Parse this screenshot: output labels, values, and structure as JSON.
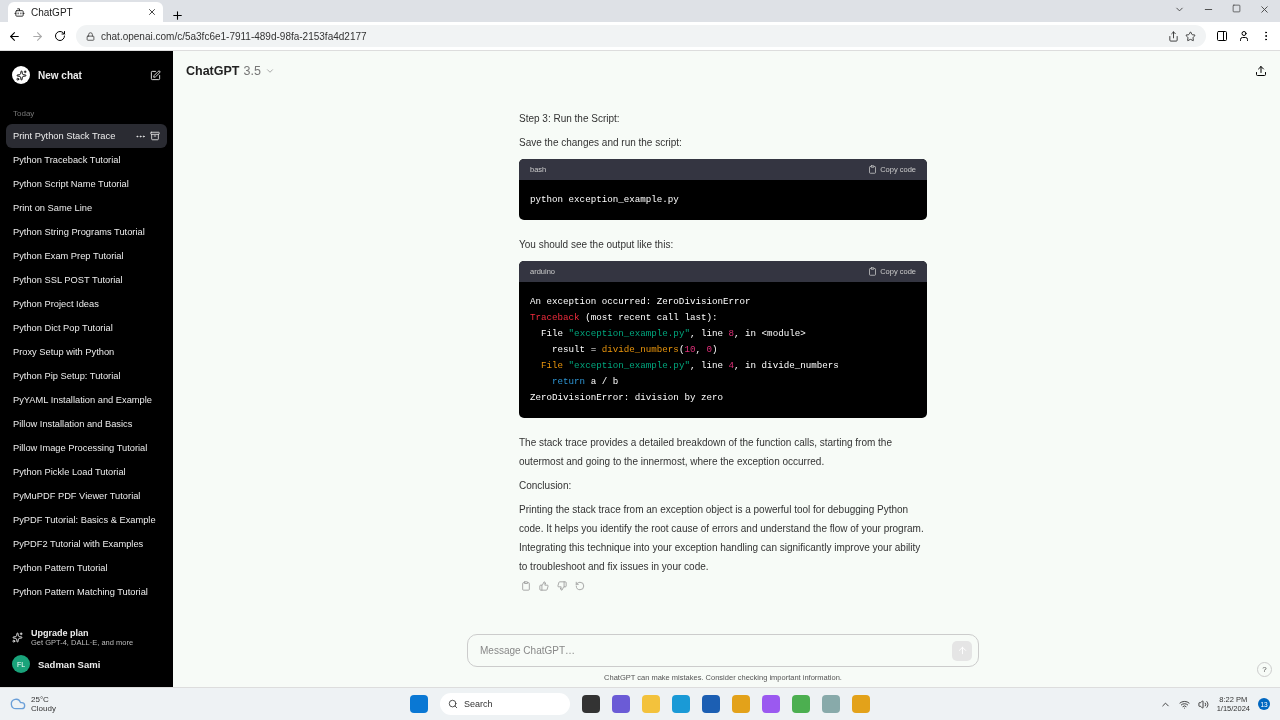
{
  "browser": {
    "tab": {
      "title": "ChatGPT"
    },
    "address": "chat.openai.com/c/5a3fc6e1-7911-489d-98fa-2153fa4d2177"
  },
  "sidebar": {
    "new_chat": "New chat",
    "section": "Today",
    "items": [
      {
        "label": "Print Python Stack Trace",
        "selected": true
      },
      {
        "label": "Python Traceback Tutorial",
        "selected": false
      },
      {
        "label": "Python Script Name Tutorial",
        "selected": false
      },
      {
        "label": "Print on Same Line",
        "selected": false
      },
      {
        "label": "Python String Programs Tutorial",
        "selected": false
      },
      {
        "label": "Python Exam Prep Tutorial",
        "selected": false
      },
      {
        "label": "Python SSL POST Tutorial",
        "selected": false
      },
      {
        "label": "Python Project Ideas",
        "selected": false
      },
      {
        "label": "Python Dict Pop Tutorial",
        "selected": false
      },
      {
        "label": "Proxy Setup with Python",
        "selected": false
      },
      {
        "label": "Python Pip Setup: Tutorial",
        "selected": false
      },
      {
        "label": "PyYAML Installation and Example",
        "selected": false
      },
      {
        "label": "Pillow Installation and Basics",
        "selected": false
      },
      {
        "label": "Pillow Image Processing Tutorial",
        "selected": false
      },
      {
        "label": "Python Pickle Load Tutorial",
        "selected": false
      },
      {
        "label": "PyMuPDF PDF Viewer Tutorial",
        "selected": false
      },
      {
        "label": "PyPDF Tutorial: Basics & Example",
        "selected": false
      },
      {
        "label": "PyPDF2 Tutorial with Examples",
        "selected": false
      },
      {
        "label": "Python Pattern Tutorial",
        "selected": false
      },
      {
        "label": "Python Pattern Matching Tutorial",
        "selected": false
      }
    ],
    "upgrade": {
      "title": "Upgrade plan",
      "subtitle": "Get GPT-4, DALL·E, and more"
    },
    "user": {
      "initials": "FL",
      "name": "Sadman Sami"
    }
  },
  "header": {
    "model": "ChatGPT",
    "version": "3.5"
  },
  "message": [
    {
      "kind": "paragraph",
      "text": "Step 3: Run the Script:"
    },
    {
      "kind": "paragraph",
      "text": "Save the changes and run the script:"
    },
    {
      "kind": "code",
      "language": "bash",
      "copy": "Copy code",
      "lines": [
        [
          {
            "kind": "plain",
            "text": "python exception_example.py"
          }
        ]
      ]
    },
    {
      "kind": "paragraph",
      "text": "You should see the output like this:"
    },
    {
      "kind": "code",
      "language": "arduino",
      "copy": "Copy code",
      "lines": [
        [
          {
            "kind": "plain",
            "text": "An exception occurred: ZeroDivisionError"
          }
        ],
        [
          {
            "kind": "error",
            "text": "Traceback"
          },
          {
            "kind": "plain",
            "text": " (most recent call last):"
          }
        ],
        [
          {
            "kind": "plain",
            "text": "  File "
          },
          {
            "kind": "string",
            "text": "\"exception_example.py\""
          },
          {
            "kind": "plain",
            "text": ", line "
          },
          {
            "kind": "number",
            "text": "8"
          },
          {
            "kind": "plain",
            "text": ", in <module>"
          }
        ],
        [
          {
            "kind": "plain",
            "text": "    result = "
          },
          {
            "kind": "function",
            "text": "divide_numbers"
          },
          {
            "kind": "plain",
            "text": "("
          },
          {
            "kind": "number",
            "text": "10"
          },
          {
            "kind": "plain",
            "text": ", "
          },
          {
            "kind": "number",
            "text": "0"
          },
          {
            "kind": "plain",
            "text": ")"
          }
        ],
        [
          {
            "kind": "function",
            "text": "  File"
          },
          {
            "kind": "string",
            "text": " \"exception_example.py\""
          },
          {
            "kind": "plain",
            "text": ", line "
          },
          {
            "kind": "number",
            "text": "4"
          },
          {
            "kind": "plain",
            "text": ", in divide_numbers"
          }
        ],
        [
          {
            "kind": "keyword",
            "text": "    return"
          },
          {
            "kind": "plain",
            "text": " a / b"
          }
        ],
        [
          {
            "kind": "plain",
            "text": "ZeroDivisionError: division by zero"
          }
        ]
      ]
    },
    {
      "kind": "paragraph",
      "text": "The stack trace provides a detailed breakdown of the function calls, starting from the outermost and going to the innermost, where the exception occurred."
    },
    {
      "kind": "paragraph",
      "text": "Conclusion:"
    },
    {
      "kind": "paragraph",
      "text": "Printing the stack trace from an exception object is a powerful tool for debugging Python code. It helps you identify the root cause of errors and understand the flow of your program. Integrating this technique into your exception handling can significantly improve your ability to troubleshoot and fix issues in your code."
    }
  ],
  "composer": {
    "placeholder": "Message ChatGPT…",
    "disclaimer": "ChatGPT can make mistakes. Consider checking important information.",
    "help": "?"
  },
  "taskbar": {
    "weather": {
      "temp": "25°C",
      "condition": "Cloudy"
    },
    "search": "Search",
    "time": "8:22 PM",
    "date": "1/15/2024",
    "notifications": "13"
  }
}
